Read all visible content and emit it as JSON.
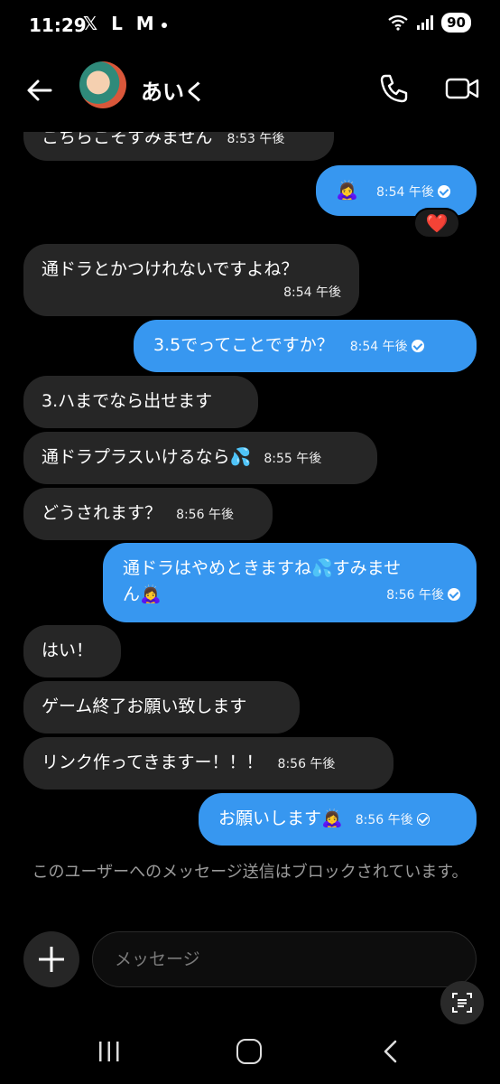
{
  "status": {
    "time": "11:29",
    "left_icons": "𝕏 L M",
    "battery": "90"
  },
  "header": {
    "contact_name": "あいく"
  },
  "messages": [
    {
      "dir": "in",
      "text": "こちらこそすみません",
      "time": "8:53 午後"
    },
    {
      "dir": "out",
      "text": "🙇‍♀️",
      "time": "8:54 午後",
      "reaction": "❤️"
    },
    {
      "dir": "in",
      "text": "通ドラとかつけれないですよね？",
      "time": "8:54 午後"
    },
    {
      "dir": "out",
      "text": "3.5でってことですか？",
      "time": "8:54 午後"
    },
    {
      "dir": "in",
      "text": "3.ハまでなら出せます",
      "time": ""
    },
    {
      "dir": "in",
      "text": "通ドラプラスいけるなら💦",
      "time": "8:55 午後"
    },
    {
      "dir": "in",
      "text": "どうされます？",
      "time": "8:56 午後"
    },
    {
      "dir": "out",
      "text": "通ドラはやめときますね💦すみません🙇‍♀️",
      "line1": "通ドラはやめときますね💦すみませ",
      "line2": "ん🙇‍♀️",
      "time": "8:56 午後"
    },
    {
      "dir": "in",
      "text": "はい！",
      "time": ""
    },
    {
      "dir": "in",
      "text": "ゲーム終了お願い致します",
      "time": ""
    },
    {
      "dir": "in",
      "text": "リンク作ってきますー！！！",
      "time": "8:56 午後"
    },
    {
      "dir": "out",
      "text": "お願いします🙇‍♀️",
      "time": "8:56 午後"
    }
  ],
  "blocked_note": "このユーザーへのメッセージ送信はブロックされています。",
  "composer": {
    "placeholder": "メッセージ"
  },
  "colors": {
    "outgoing": "#3797f0",
    "incoming": "#262626",
    "background": "#000000"
  }
}
